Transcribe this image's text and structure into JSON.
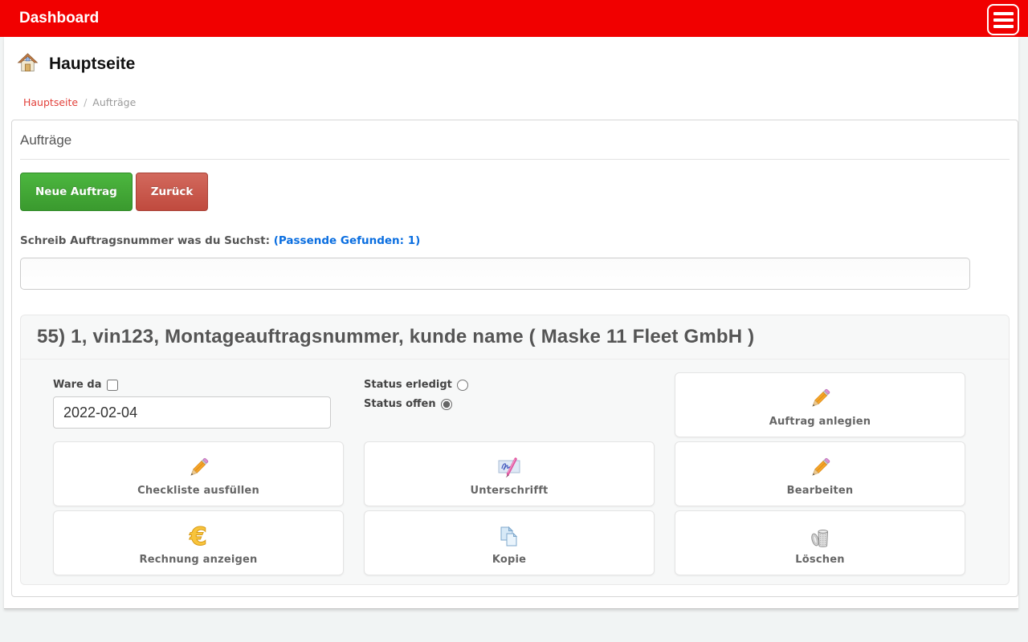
{
  "header": {
    "title": "Dashboard"
  },
  "page": {
    "heading": "Hauptseite"
  },
  "breadcrumb": {
    "home": "Hauptseite",
    "separator": "/",
    "current": "Aufträge"
  },
  "panel": {
    "title": "Aufträge"
  },
  "toolbar": {
    "new_button": "Neue Auftrag",
    "back_button": "Zurück"
  },
  "search": {
    "label": "Schreib Auftragsnummer was du Suchst:",
    "matches": "(Passende Gefunden: 1)",
    "value": ""
  },
  "record": {
    "heading": "55) 1, vin123, Montageauftragsnummer, kunde name ( Maske 11 Fleet GmbH )",
    "ware_da": {
      "label": "Ware da",
      "checked": false
    },
    "date_value": "2022-02-04",
    "status": {
      "erledigt_label": "Status erledigt",
      "offen_label": "Status offen",
      "selected": "offen"
    },
    "actions": [
      {
        "label": "Auftrag anlegien",
        "icon": "pencil-icon"
      },
      {
        "label": "Checkliste ausfüllen",
        "icon": "pencil-icon"
      },
      {
        "label": "Unterschrifft",
        "icon": "signature-icon"
      },
      {
        "label": "Bearbeiten",
        "icon": "pencil-icon"
      },
      {
        "label": "Rechnung anzeigen",
        "icon": "euro-icon"
      },
      {
        "label": "Kopie",
        "icon": "copy-icon"
      },
      {
        "label": "Löschen",
        "icon": "trash-icon"
      }
    ]
  },
  "icons": {
    "menu": "hamburger-icon",
    "home": "house-icon",
    "euro_glyph": "€"
  },
  "colors": {
    "topbar_red": "#f10000",
    "button_green": "#3a9a2e",
    "button_red": "#c04a3e",
    "link_blue": "#0a6ee0",
    "breadcrumb_red": "#e2403a",
    "page_background": "#f1f4f4"
  }
}
